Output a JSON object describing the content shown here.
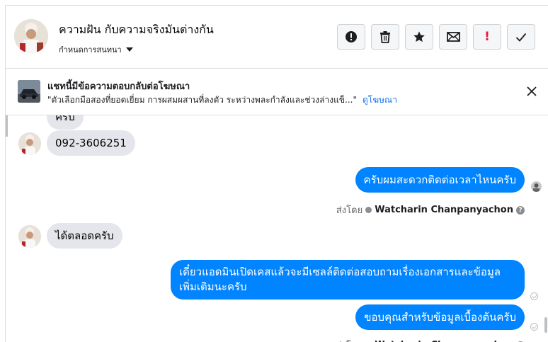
{
  "header": {
    "title": "ความฝัน กับความจริงมันต่างกัน",
    "subtitle": "กำหนดการสนทนา",
    "actions": [
      {
        "icon": "report-icon",
        "label": ""
      },
      {
        "icon": "trash-icon",
        "label": ""
      },
      {
        "icon": "star-icon",
        "label": ""
      },
      {
        "icon": "mail-icon",
        "label": ""
      },
      {
        "icon": "mark-important-icon",
        "label": "!"
      },
      {
        "icon": "checkmark-icon",
        "label": ""
      }
    ]
  },
  "ad_banner": {
    "title": "แชทนี้มีข้อความตอบกลับต่อโฆษณา",
    "text": "\"ตัวเลือกมือสองที่ยอดเยี่ยม การผสมผสานที่ลงตัว ระหว่างพละกำลังและช่วงล่างแข็...\"",
    "link": "ดูโฆษณา"
  },
  "messages": [
    {
      "direction": "in",
      "text": "ครับ"
    },
    {
      "direction": "in",
      "text": "092-3606251"
    },
    {
      "direction": "out",
      "text": "ครับผมสะดวกติดต่อเวลาไหนครับ"
    },
    {
      "direction": "in",
      "text": "ได้ตลอดครับ"
    },
    {
      "direction": "out",
      "text": "เดี๋ยวแอดมินเปิดเคสแล้วจะมีเซลล์ติดต่อสอบถามเรื่องเอกสารและข้อมูลเพิ่มเติมนะครับ"
    },
    {
      "direction": "out",
      "text": "ขอบคุณสำหรับข้อมูลเบื้องต้นครับ"
    }
  ],
  "sent_by": {
    "prefix": "ส่งโดย",
    "name": "Watcharin Chanpanyachon",
    "help": "?"
  },
  "colors": {
    "accent": "#0084ff",
    "incoming_bubble": "#e4e6eb",
    "link": "#1877f2",
    "important": "#e41e3f"
  }
}
